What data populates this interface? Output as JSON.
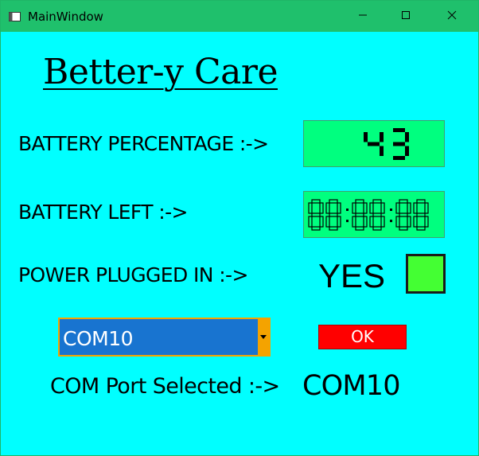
{
  "window": {
    "title": "MainWindow",
    "icon": "window-app-icon",
    "controls": [
      "minimize-icon",
      "maximize-icon",
      "close-icon"
    ],
    "background_color": "#00ffff",
    "titlebar_color": "#1fc06c"
  },
  "app": {
    "title": "Better-y Care"
  },
  "battery_percentage": {
    "label": "BATTERY PERCENTAGE :->",
    "value": "43",
    "display_color": "#00ff7f"
  },
  "battery_left": {
    "label": "BATTERY LEFT :->",
    "value": "00:00:00"
  },
  "power": {
    "label": "POWER PLUGGED IN  :->",
    "value": "YES",
    "indicator_color": "#44ff33"
  },
  "com_port": {
    "selected": "COM10",
    "combo_color": "#1874d0",
    "arrow_color": "#f4a300",
    "ok_label": "OK",
    "ok_color": "#ff0000",
    "selected_label": "COM Port Selected :->",
    "selected_value": "COM10"
  }
}
